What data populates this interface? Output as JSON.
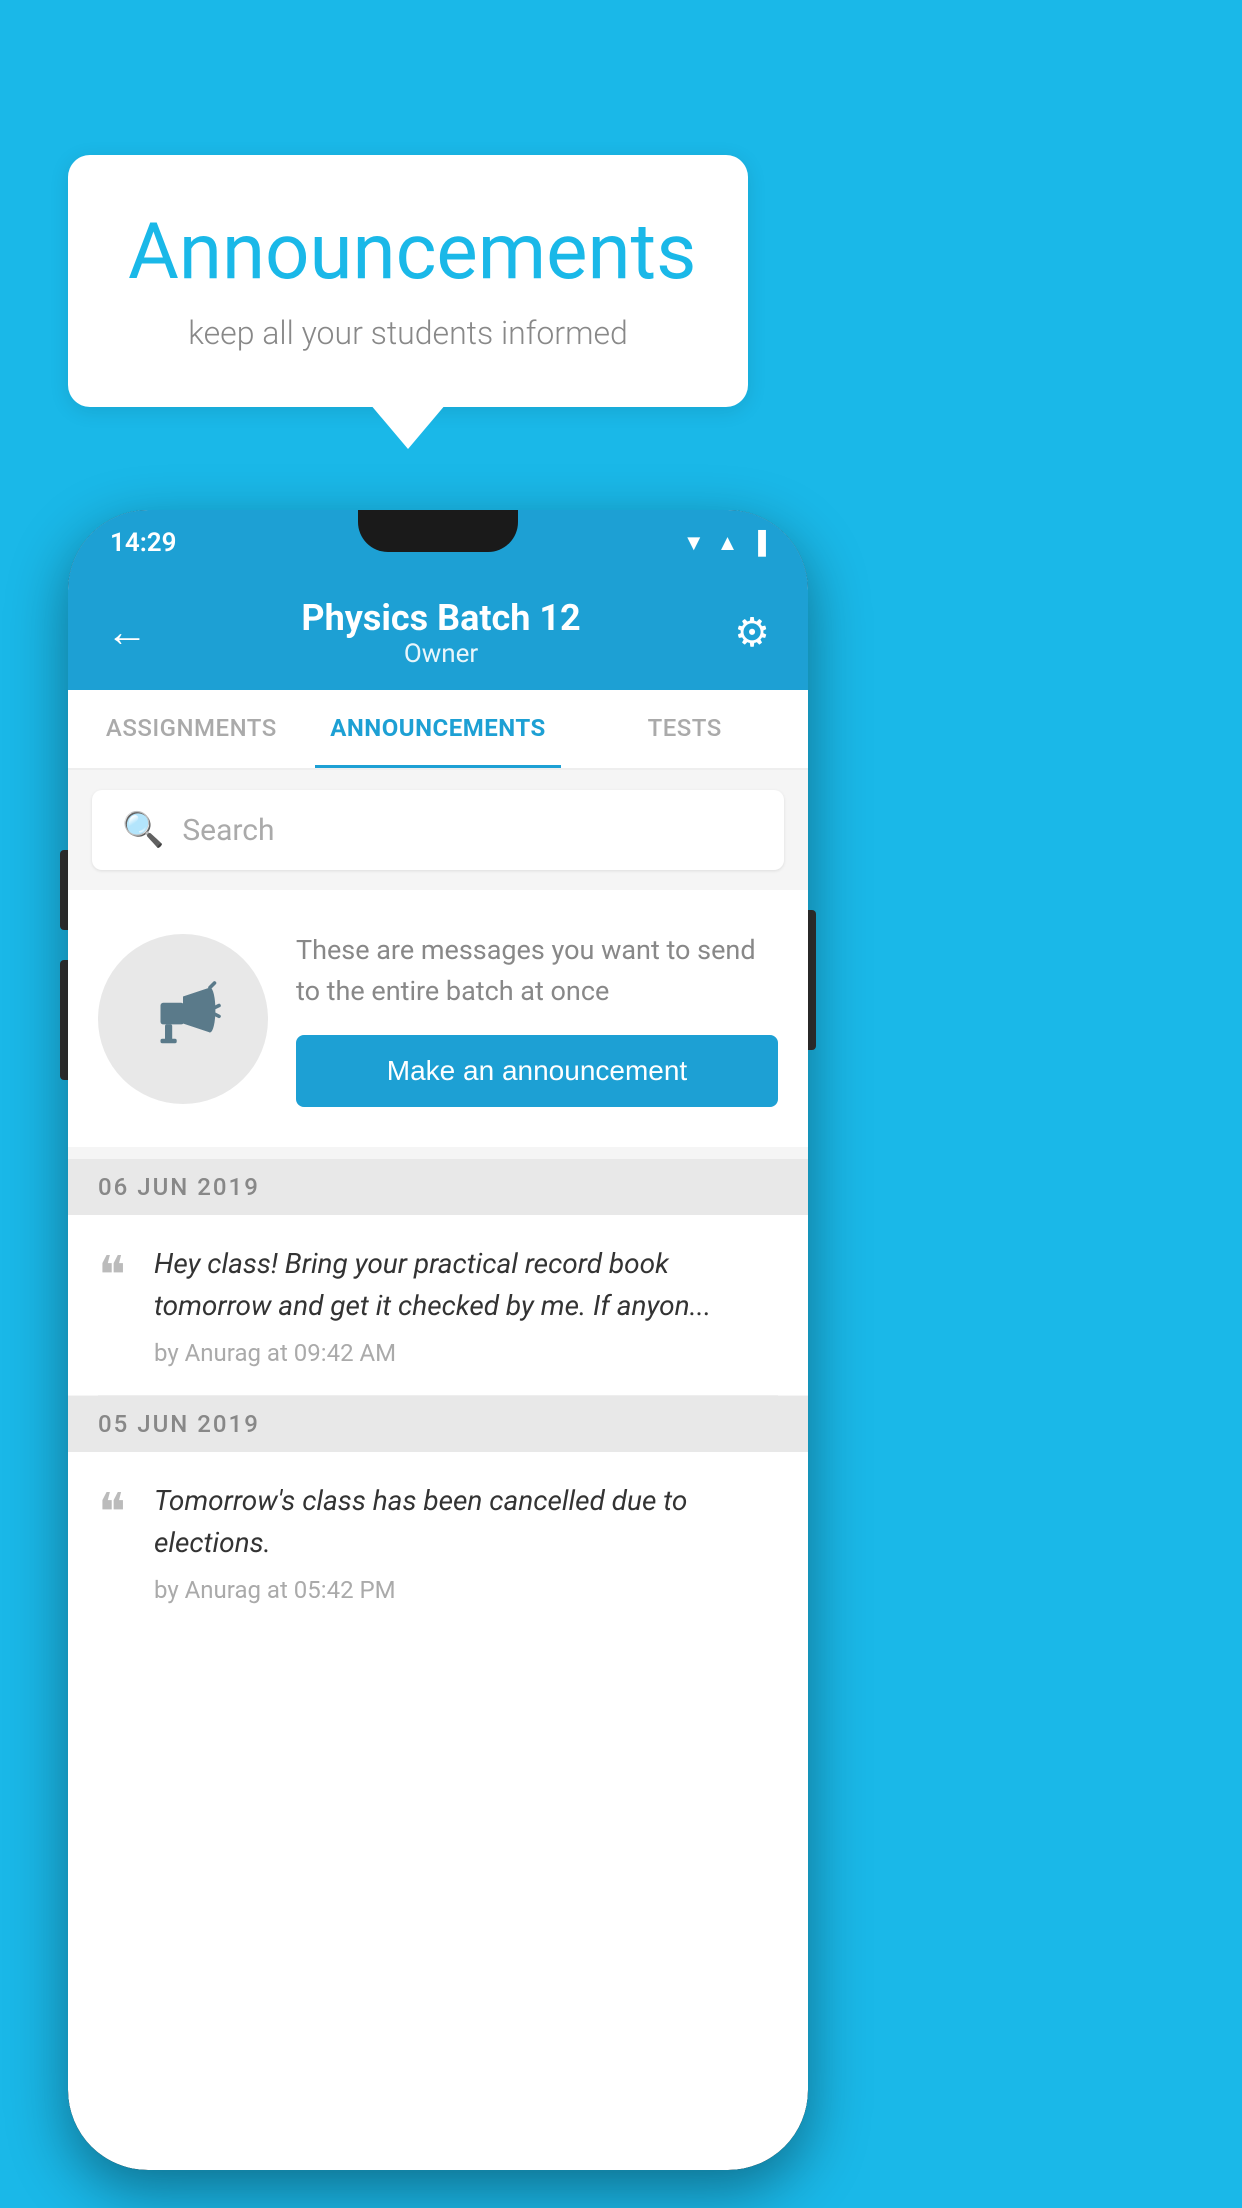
{
  "background_color": "#1ab8e8",
  "speech_bubble": {
    "title": "Announcements",
    "subtitle": "keep all your students informed"
  },
  "phone": {
    "status_bar": {
      "time": "14:29",
      "wifi": "▲",
      "signal": "▲",
      "battery": "▐"
    },
    "header": {
      "back_label": "←",
      "title": "Physics Batch 12",
      "subtitle": "Owner",
      "settings_label": "⚙"
    },
    "tabs": [
      {
        "label": "ASSIGNMENTS",
        "active": false
      },
      {
        "label": "ANNOUNCEMENTS",
        "active": true
      },
      {
        "label": "TESTS",
        "active": false
      }
    ],
    "search": {
      "placeholder": "Search"
    },
    "promo": {
      "description": "These are messages you want to send to the entire batch at once",
      "button_label": "Make an announcement"
    },
    "announcements": [
      {
        "date": "06  JUN  2019",
        "text": "Hey class! Bring your practical record book tomorrow and get it checked by me. If anyon...",
        "meta": "by Anurag at 09:42 AM"
      },
      {
        "date": "05  JUN  2019",
        "text": "Tomorrow's class has been cancelled due to elections.",
        "meta": "by Anurag at 05:42 PM"
      }
    ]
  }
}
